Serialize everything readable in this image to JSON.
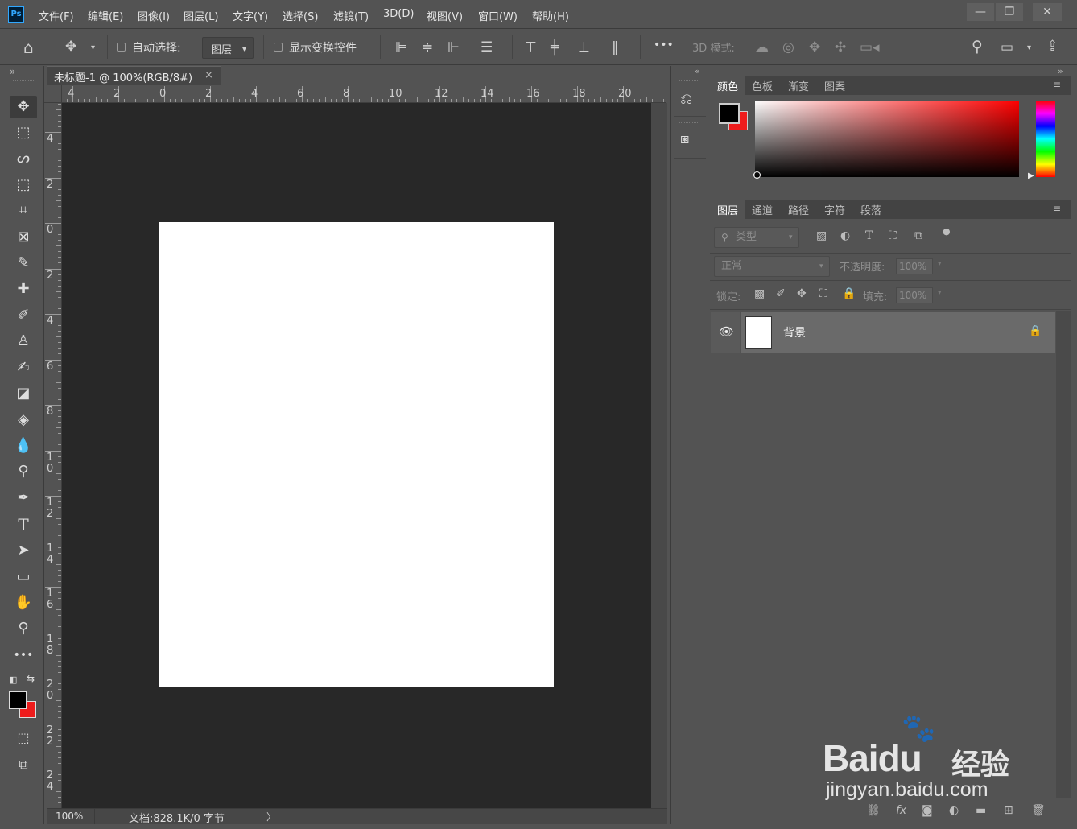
{
  "app": {
    "logo": "Ps"
  },
  "menu": [
    "文件(F)",
    "编辑(E)",
    "图像(I)",
    "图层(L)",
    "文字(Y)",
    "选择(S)",
    "滤镜(T)",
    "3D(D)",
    "视图(V)",
    "窗口(W)",
    "帮助(H)"
  ],
  "window_controls": {
    "minimize": "—",
    "restore": "❐",
    "close": "✕"
  },
  "options": {
    "auto_select_label": "自动选择:",
    "auto_select_target": "图层",
    "show_transform_label": "显示变换控件",
    "more": "•••",
    "mode_3d_label": "3D 模式:"
  },
  "document": {
    "tab_title": "未标题-1 @ 100%(RGB/8#)",
    "close": "×",
    "zoom": "100%",
    "doc_info": "文档:828.1K/0 字节",
    "status_arrow": "〉"
  },
  "ruler": {
    "h_labels": [
      "4",
      "2",
      "0",
      "2",
      "4",
      "6",
      "8",
      "10",
      "12",
      "14",
      "16",
      "18",
      "20"
    ],
    "v_labels": [
      "4",
      "2",
      "0",
      "2",
      "4",
      "6",
      "8",
      "10",
      "12",
      "14",
      "16",
      "18",
      "20",
      "22",
      "24"
    ]
  },
  "toolbox": {
    "expand": "»",
    "tools": [
      "move-icon",
      "marquee-icon",
      "lasso-icon",
      "object-select-icon",
      "crop-icon",
      "frame-icon",
      "eyedropper-icon",
      "healing-icon",
      "brush-icon",
      "stamp-icon",
      "history-brush-icon",
      "eraser-icon",
      "paint-bucket-icon",
      "blur-icon",
      "dodge-icon",
      "pen-icon",
      "type-icon",
      "path-select-icon",
      "rectangle-icon",
      "hand-icon",
      "zoom-icon",
      "more-tools-icon"
    ],
    "foreground_color": "#000000",
    "background_color": "#ee1c1c"
  },
  "color_panel": {
    "tabs": [
      "颜色",
      "色板",
      "渐变",
      "图案"
    ],
    "active_tab": "颜色",
    "hue": "#ff0000",
    "foreground": "#000000",
    "background": "#ee1c1c"
  },
  "layers_panel": {
    "tabs": [
      "图层",
      "通道",
      "路径",
      "字符",
      "段落"
    ],
    "active_tab": "图层",
    "filter_label": "类型",
    "blend_mode": "正常",
    "opacity_label": "不透明度:",
    "opacity_value": "100%",
    "lock_label": "锁定:",
    "fill_label": "填充:",
    "fill_value": "100%",
    "layers": [
      {
        "name": "背景",
        "visible": true,
        "locked": true
      }
    ]
  },
  "watermark": {
    "brand": "Baidu",
    "sub": "经验",
    "url": "jingyan.baidu.com"
  }
}
